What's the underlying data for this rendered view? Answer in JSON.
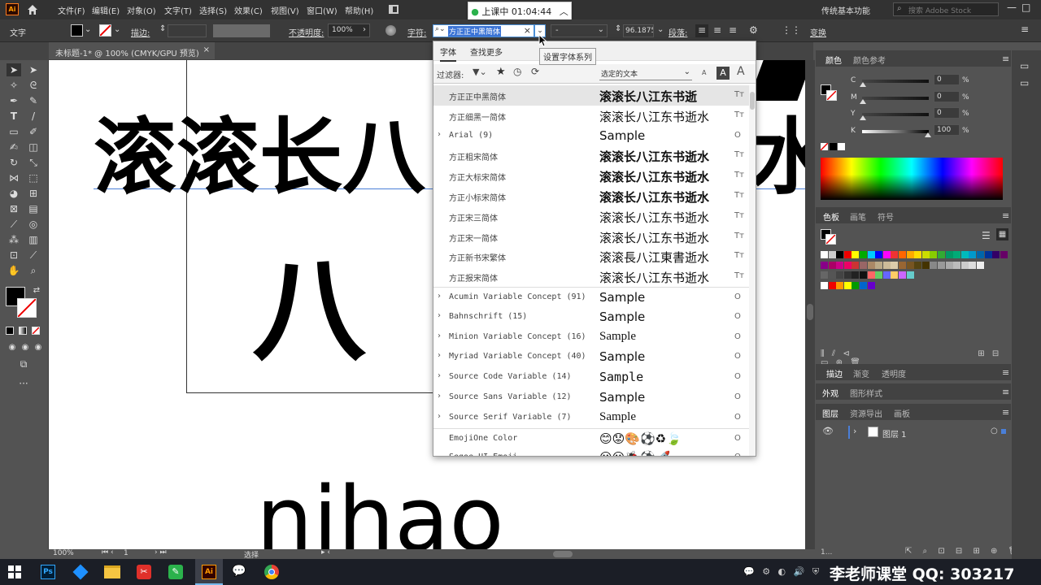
{
  "app": {
    "logo": "Ai",
    "workspace": "传统基本功能",
    "search_placeholder": "搜索 Adobe Stock"
  },
  "menu": [
    "文件(F)",
    "编辑(E)",
    "对象(O)",
    "文字(T)",
    "选择(S)",
    "效果(C)",
    "视图(V)",
    "窗口(W)",
    "帮助(H)"
  ],
  "control": {
    "tool_label": "文字",
    "stroke_label": "描边:",
    "opacity_label": "不透明度:",
    "opacity_value": "100%",
    "char_label": "字符:",
    "font_field": "方正正中黑简体",
    "style_field": "-",
    "size_value": "96.1875",
    "para_label": "段落:",
    "transform_label": "变换"
  },
  "timer": {
    "text": "上课中 01:04:44"
  },
  "tooltip": "设置字体系列",
  "doc_tab": {
    "title": "未标题-1* @ 100% (CMYK/GPU 预览)",
    "close": "×"
  },
  "canvas": {
    "line1": "滚滚长八",
    "line1b": "水",
    "line2": "八",
    "line3": "nihao"
  },
  "font_menu": {
    "tabs": [
      "字体",
      "查找更多"
    ],
    "filter_label": "过滤器:",
    "preview_label": "选定的文本",
    "rows": [
      {
        "name": "方正正中黑简体",
        "sample": "滚滚长八江东书逝",
        "icon": "Tт",
        "expand": ""
      },
      {
        "name": "方正细黑一简体",
        "sample": "滚滚长八江东书逝水",
        "icon": "Tт",
        "expand": ""
      },
      {
        "name": "Arial (9)",
        "sample": "Sample",
        "icon": "O",
        "expand": "›"
      },
      {
        "name": "方正粗宋简体",
        "sample": "滚滚长八江东书逝水",
        "icon": "Tт",
        "expand": ""
      },
      {
        "name": "方正大标宋简体",
        "sample": "滚滚长八江东书逝水",
        "icon": "Tт",
        "expand": ""
      },
      {
        "name": "方正小标宋简体",
        "sample": "滚滚长八江东书逝水",
        "icon": "Tт",
        "expand": ""
      },
      {
        "name": "方正宋三简体",
        "sample": "滚滚长八江东书逝水",
        "icon": "Tт",
        "expand": ""
      },
      {
        "name": "方正宋一简体",
        "sample": "滚滚长八江东书逝水",
        "icon": "Tт",
        "expand": ""
      },
      {
        "name": "方正新书宋繁体",
        "sample": "滚滚長八江東書逝水",
        "icon": "Tт",
        "expand": ""
      },
      {
        "name": "方正报宋简体",
        "sample": "滚滚长八江东书逝水",
        "icon": "Tт",
        "expand": ""
      },
      {
        "name": "Acumin Variable Concept (91)",
        "sample": "Sample",
        "icon": "O",
        "expand": "›"
      },
      {
        "name": "Bahnschrift (15)",
        "sample": "Sample",
        "icon": "O",
        "expand": "›"
      },
      {
        "name": "Minion Variable Concept (16)",
        "sample": "Sample",
        "icon": "O",
        "expand": "›"
      },
      {
        "name": "Myriad Variable Concept (40)",
        "sample": "Sample",
        "icon": "O",
        "expand": "›"
      },
      {
        "name": "Source Code Variable (14)",
        "sample": "Sample",
        "icon": "O",
        "expand": "›"
      },
      {
        "name": "Source Sans Variable (12)",
        "sample": "Sample",
        "icon": "O",
        "expand": "›"
      },
      {
        "name": "Source Serif Variable (7)",
        "sample": "Sample",
        "icon": "O",
        "expand": "›"
      },
      {
        "name": "EmojiOne Color",
        "sample": "😊😟🎨⚽♻🍃",
        "icon": "O",
        "expand": ""
      },
      {
        "name": "Segoe UI Emoji",
        "sample": "😃😐🐞⚽🚀",
        "icon": "O",
        "expand": ""
      }
    ]
  },
  "panels": {
    "color_tabs": [
      "颜色",
      "颜色参考"
    ],
    "cmyk": [
      {
        "ch": "C",
        "val": "0"
      },
      {
        "ch": "M",
        "val": "0"
      },
      {
        "ch": "Y",
        "val": "0"
      },
      {
        "ch": "K",
        "val": "100"
      }
    ],
    "pct": "%",
    "swatch_tabs": [
      "色板",
      "画笔",
      "符号"
    ],
    "stroke_tabs": [
      "描边",
      "渐变",
      "透明度"
    ],
    "appearance_tabs": [
      "外观",
      "图形样式"
    ],
    "layer_tabs": [
      "图层",
      "资源导出",
      "画板"
    ],
    "layer_name": "图层 1",
    "layer_count": "1..."
  },
  "status": {
    "zoom": "100%",
    "artboard": "1",
    "tool": "选择"
  },
  "watermark": "李老师课堂 QQ: 303217"
}
